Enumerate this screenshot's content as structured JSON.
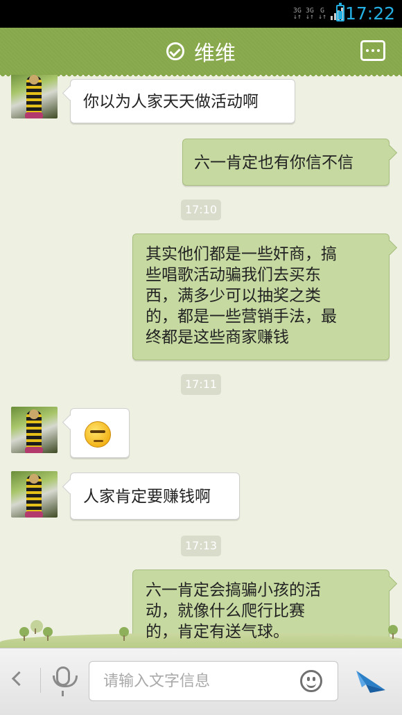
{
  "status_bar": {
    "network_1": "3G",
    "network_2": "3G",
    "network_3": "G",
    "clock": "17:22",
    "battery_level": 0.6,
    "accent_color": "#25b0e3"
  },
  "header": {
    "title": "维维",
    "status_icon": "check-circle-icon",
    "menu_icon": "more-icon",
    "background_color": "#87a84a"
  },
  "messages": [
    {
      "side": "left",
      "type": "text",
      "text": "你以为人家天天做活动啊"
    },
    {
      "side": "right",
      "type": "text",
      "text": "六一肯定也有你信不信"
    },
    {
      "type": "timestamp",
      "text": "17:10"
    },
    {
      "side": "right",
      "type": "text",
      "text": "其实他们都是一些奸商，搞\n些唱歌活动骗我们去买东\n西，满多少可以抽奖之类\n的，都是一些营销手法，最\n终都是这些商家赚钱"
    },
    {
      "type": "timestamp",
      "text": "17:11"
    },
    {
      "side": "left",
      "type": "emoji",
      "icon": "smirk-emoji-icon"
    },
    {
      "side": "left",
      "type": "text",
      "text": "人家肯定要赚钱啊"
    },
    {
      "type": "timestamp",
      "text": "17:13"
    },
    {
      "side": "right",
      "type": "text",
      "text": "六一肯定会搞骗小孩的活\n动，就像什么爬行比赛\n的，肯定有送气球。"
    }
  ],
  "input_bar": {
    "placeholder": "请输入文字信息",
    "value": "",
    "back_icon": "chevron-left-icon",
    "voice_icon": "microphone-icon",
    "emoji_icon": "smiley-icon",
    "send_icon": "send-icon",
    "send_color": "#2a7fc6"
  }
}
